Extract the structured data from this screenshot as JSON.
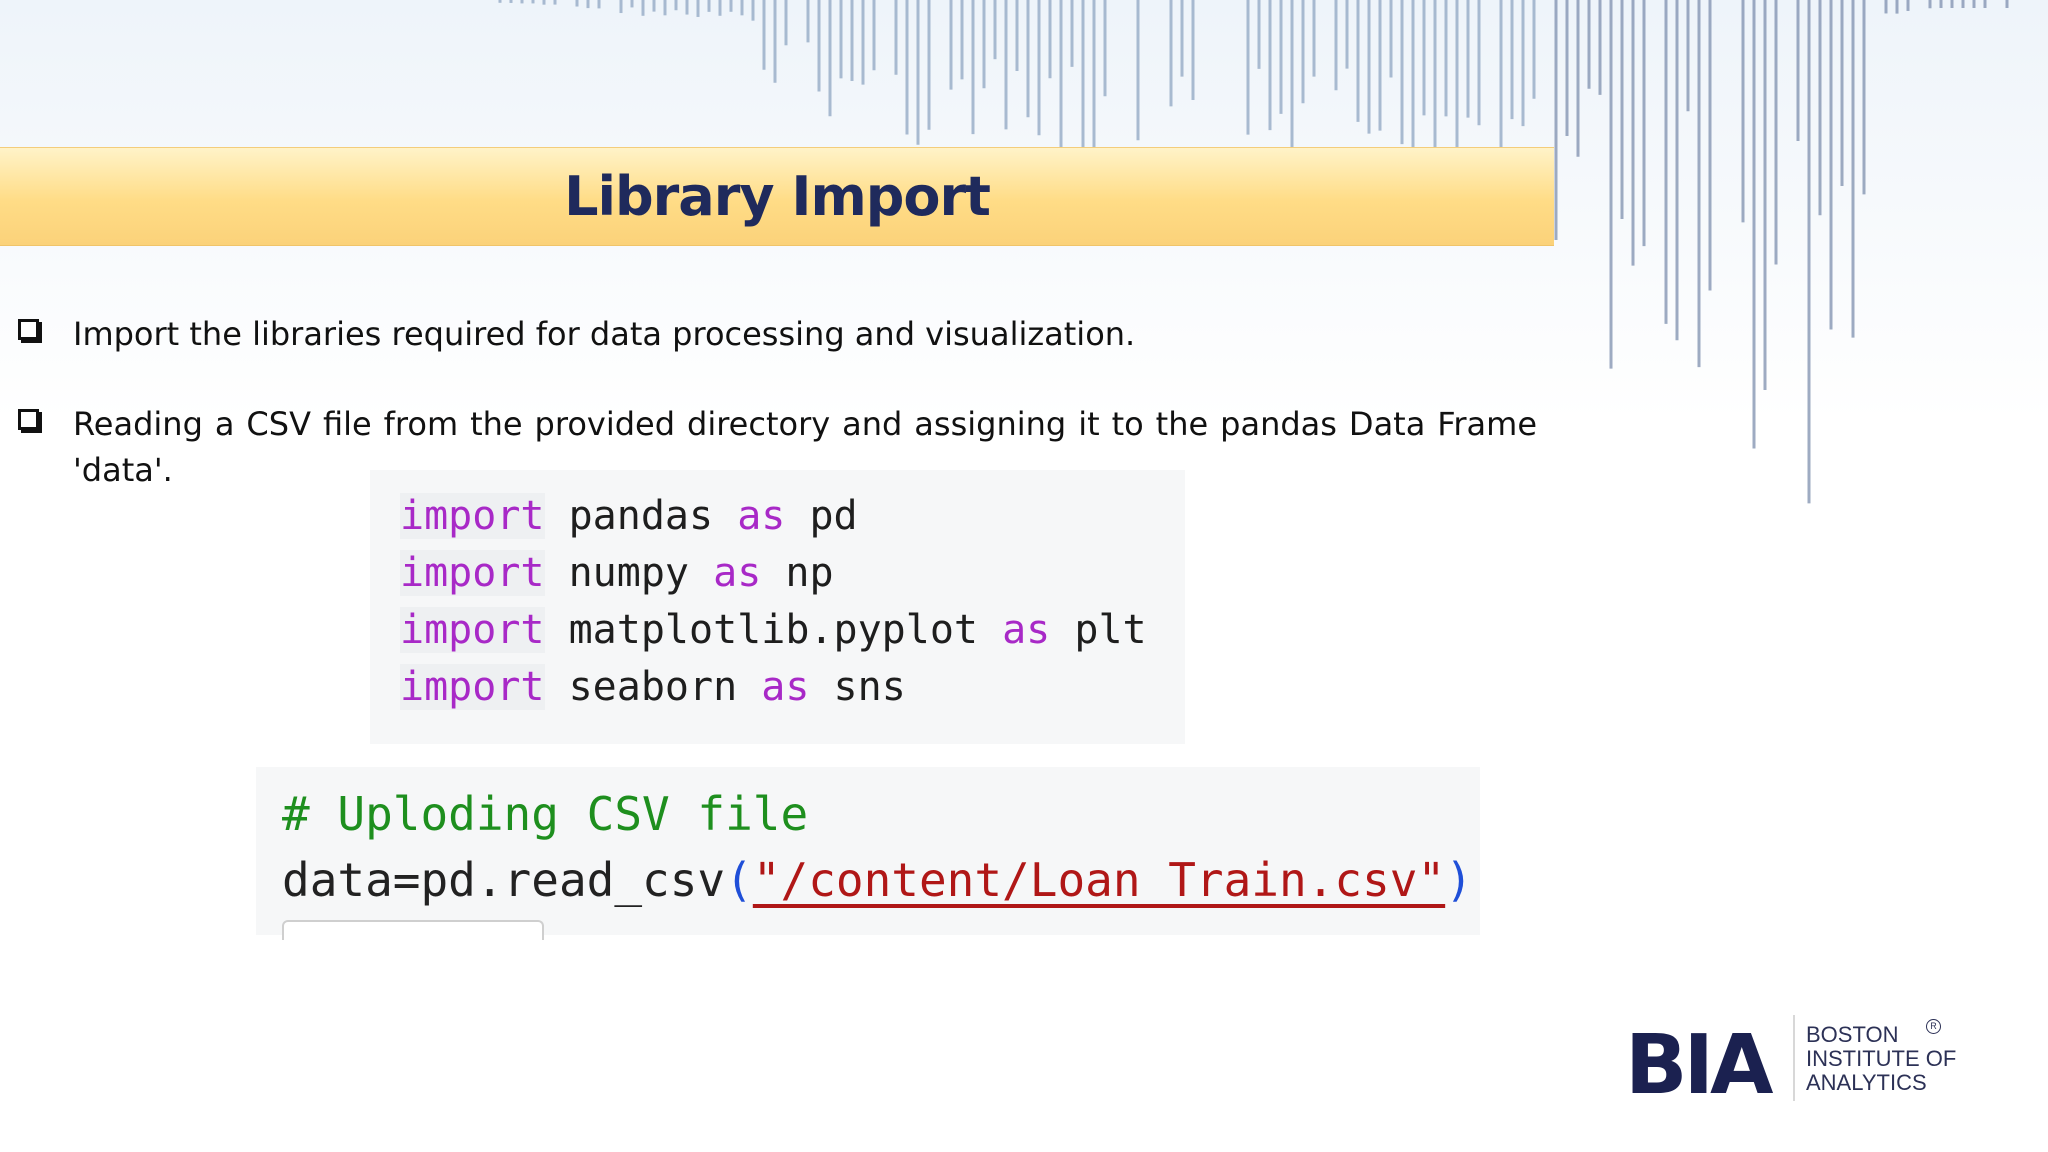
{
  "slide": {
    "title": "Library Import",
    "bullets": [
      "Import the libraries required for data processing and visualization.",
      "Reading a CSV file from the provided directory and assigning it to the pandas Data Frame 'data'."
    ]
  },
  "code_block_imports": {
    "lines": [
      {
        "kw": "import",
        "module": "pandas",
        "as": "as",
        "alias": "pd"
      },
      {
        "kw": "import",
        "module": "numpy",
        "as": "as",
        "alias": "np"
      },
      {
        "kw": "import",
        "module": "matplotlib.pyplot",
        "as": "as",
        "alias": "plt"
      },
      {
        "kw": "import",
        "module": "seaborn",
        "as": "as",
        "alias": "sns"
      }
    ]
  },
  "code_block_read": {
    "comment": "# Uploding CSV file",
    "call_prefix": "data=pd.read_csv",
    "open_paren": "(",
    "path_string": "\"/content/Loan_Train.csv\"",
    "close_paren": ")"
  },
  "logo": {
    "mark": "BIA",
    "line1": "BOSTON",
    "line2": "INSTITUTE OF",
    "line3": "ANALYTICS",
    "registered": "R"
  },
  "colors": {
    "title_text": "#1f2a5c",
    "title_bar": "#ffdc86",
    "keyword": "#a829c7",
    "comment": "#1e8f1e",
    "string": "#b01717",
    "paren": "#1f4fd8",
    "logo": "#1b2150"
  }
}
